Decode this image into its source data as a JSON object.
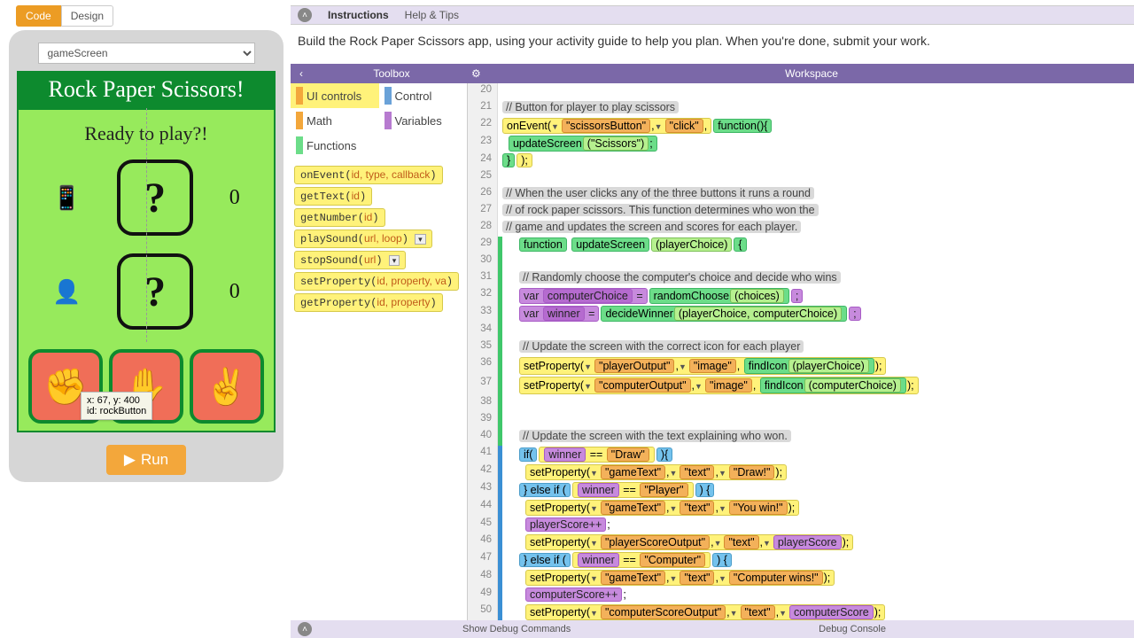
{
  "tabs": {
    "code": "Code",
    "design": "Design"
  },
  "screenSelect": "gameScreen",
  "app": {
    "title": "Rock Paper Scissors!",
    "ready": "Ready to play?!",
    "playerScore": "0",
    "computerScore": "0",
    "tooltip_line1": "x: 67, y: 400",
    "tooltip_line2": "id: rockButton",
    "run": "Run"
  },
  "topBar": {
    "instructions": "Instructions",
    "help": "Help & Tips"
  },
  "instructionsText": "Build the Rock Paper Scissors app, using your activity guide to help you plan. When you're done, submit your work.",
  "purple": {
    "toolbox": "Toolbox",
    "workspace": "Workspace"
  },
  "categories": [
    {
      "label": "UI controls",
      "color": "#f3a73b",
      "active": true
    },
    {
      "label": "Control",
      "color": "#6aa2d8"
    },
    {
      "label": "Math",
      "color": "#f3a73b"
    },
    {
      "label": "Variables",
      "color": "#b77bd0"
    },
    {
      "label": "Functions",
      "color": "#6cdd89"
    }
  ],
  "commands": [
    {
      "name": "onEvent",
      "params": "id, type, callback"
    },
    {
      "name": "getText",
      "params": "id"
    },
    {
      "name": "getNumber",
      "params": "id"
    },
    {
      "name": "playSound",
      "params": "url, loop",
      "btn": true
    },
    {
      "name": "stopSound",
      "params": "url",
      "btn": true
    },
    {
      "name": "setProperty",
      "params": "id, property, va"
    },
    {
      "name": "getProperty",
      "params": "id, property"
    }
  ],
  "code": {
    "20": {
      "t": ""
    },
    "21": {
      "t": "comment",
      "text": "// Button for player to play scissors"
    },
    "22": {
      "t": "onEvent",
      "id": "\"scissorsButton\"",
      "type": "\"click\"",
      "cb": "function(){"
    },
    "23": {
      "t": "callGreen",
      "fn": "updateScreen",
      "arg": "\"Scissors\""
    },
    "24": {
      "t": "closeCb"
    },
    "25": {
      "t": ""
    },
    "26": {
      "t": "comment",
      "text": "// When the user clicks any of the three buttons it runs a round"
    },
    "27": {
      "t": "comment",
      "text": "// of rock paper scissors. This function determines who won the"
    },
    "28": {
      "t": "comment",
      "text": "// game and updates the screen and scores for each player."
    },
    "29": {
      "t": "funcDef",
      "name": "updateScreen",
      "params": "playerChoice"
    },
    "30": {
      "t": "greenEmpty"
    },
    "31": {
      "t": "comment",
      "green": true,
      "text": "// Randomly choose the computer's choice and decide who wins"
    },
    "32": {
      "t": "varAssignCall",
      "name": "computerChoice",
      "fn": "randomChoose",
      "arg": "choices"
    },
    "33": {
      "t": "varAssignCall",
      "name": "winner",
      "fn": "decideWinner",
      "arg": "playerChoice, computerChoice"
    },
    "34": {
      "t": "greenEmpty"
    },
    "35": {
      "t": "comment",
      "green": true,
      "text": "// Update the screen with the correct icon for each player"
    },
    "36": {
      "t": "setPropCall",
      "id": "\"playerOutput\"",
      "prop": "\"image\"",
      "fn": "findIcon",
      "arg": "playerChoice"
    },
    "37": {
      "t": "setPropCall",
      "id": "\"computerOutput\"",
      "prop": "\"image\"",
      "fn": "findIcon",
      "arg": "computerChoice"
    },
    "38": {
      "t": "greenEmpty"
    },
    "39": {
      "t": "greenEmpty"
    },
    "40": {
      "t": "comment",
      "green": true,
      "text": "// Update the screen with the text explaining who won."
    },
    "41": {
      "t": "if",
      "var": "winner",
      "cmp": "\"Draw\""
    },
    "42": {
      "t": "setPropLit",
      "id": "\"gameText\"",
      "prop": "\"text\"",
      "val": "\"Draw!\""
    },
    "43": {
      "t": "elseif",
      "var": "winner",
      "cmp": "\"Player\""
    },
    "44": {
      "t": "setPropLit",
      "id": "\"gameText\"",
      "prop": "\"text\"",
      "val": "\"You win!\""
    },
    "45": {
      "t": "inc",
      "var": "playerScore"
    },
    "46": {
      "t": "setPropVar",
      "id": "\"playerScoreOutput\"",
      "prop": "\"text\"",
      "var": "playerScore"
    },
    "47": {
      "t": "elseif",
      "var": "winner",
      "cmp": "\"Computer\""
    },
    "48": {
      "t": "setPropLit",
      "id": "\"gameText\"",
      "prop": "\"text\"",
      "val": "\"Computer wins!\""
    },
    "49": {
      "t": "inc",
      "var": "computerScore"
    },
    "50": {
      "t": "setPropVar",
      "id": "\"computerScoreOutput\"",
      "prop": "\"text\"",
      "var": "computerScore"
    }
  },
  "bottom": {
    "showDebug": "Show Debug Commands",
    "debugConsole": "Debug Console"
  }
}
